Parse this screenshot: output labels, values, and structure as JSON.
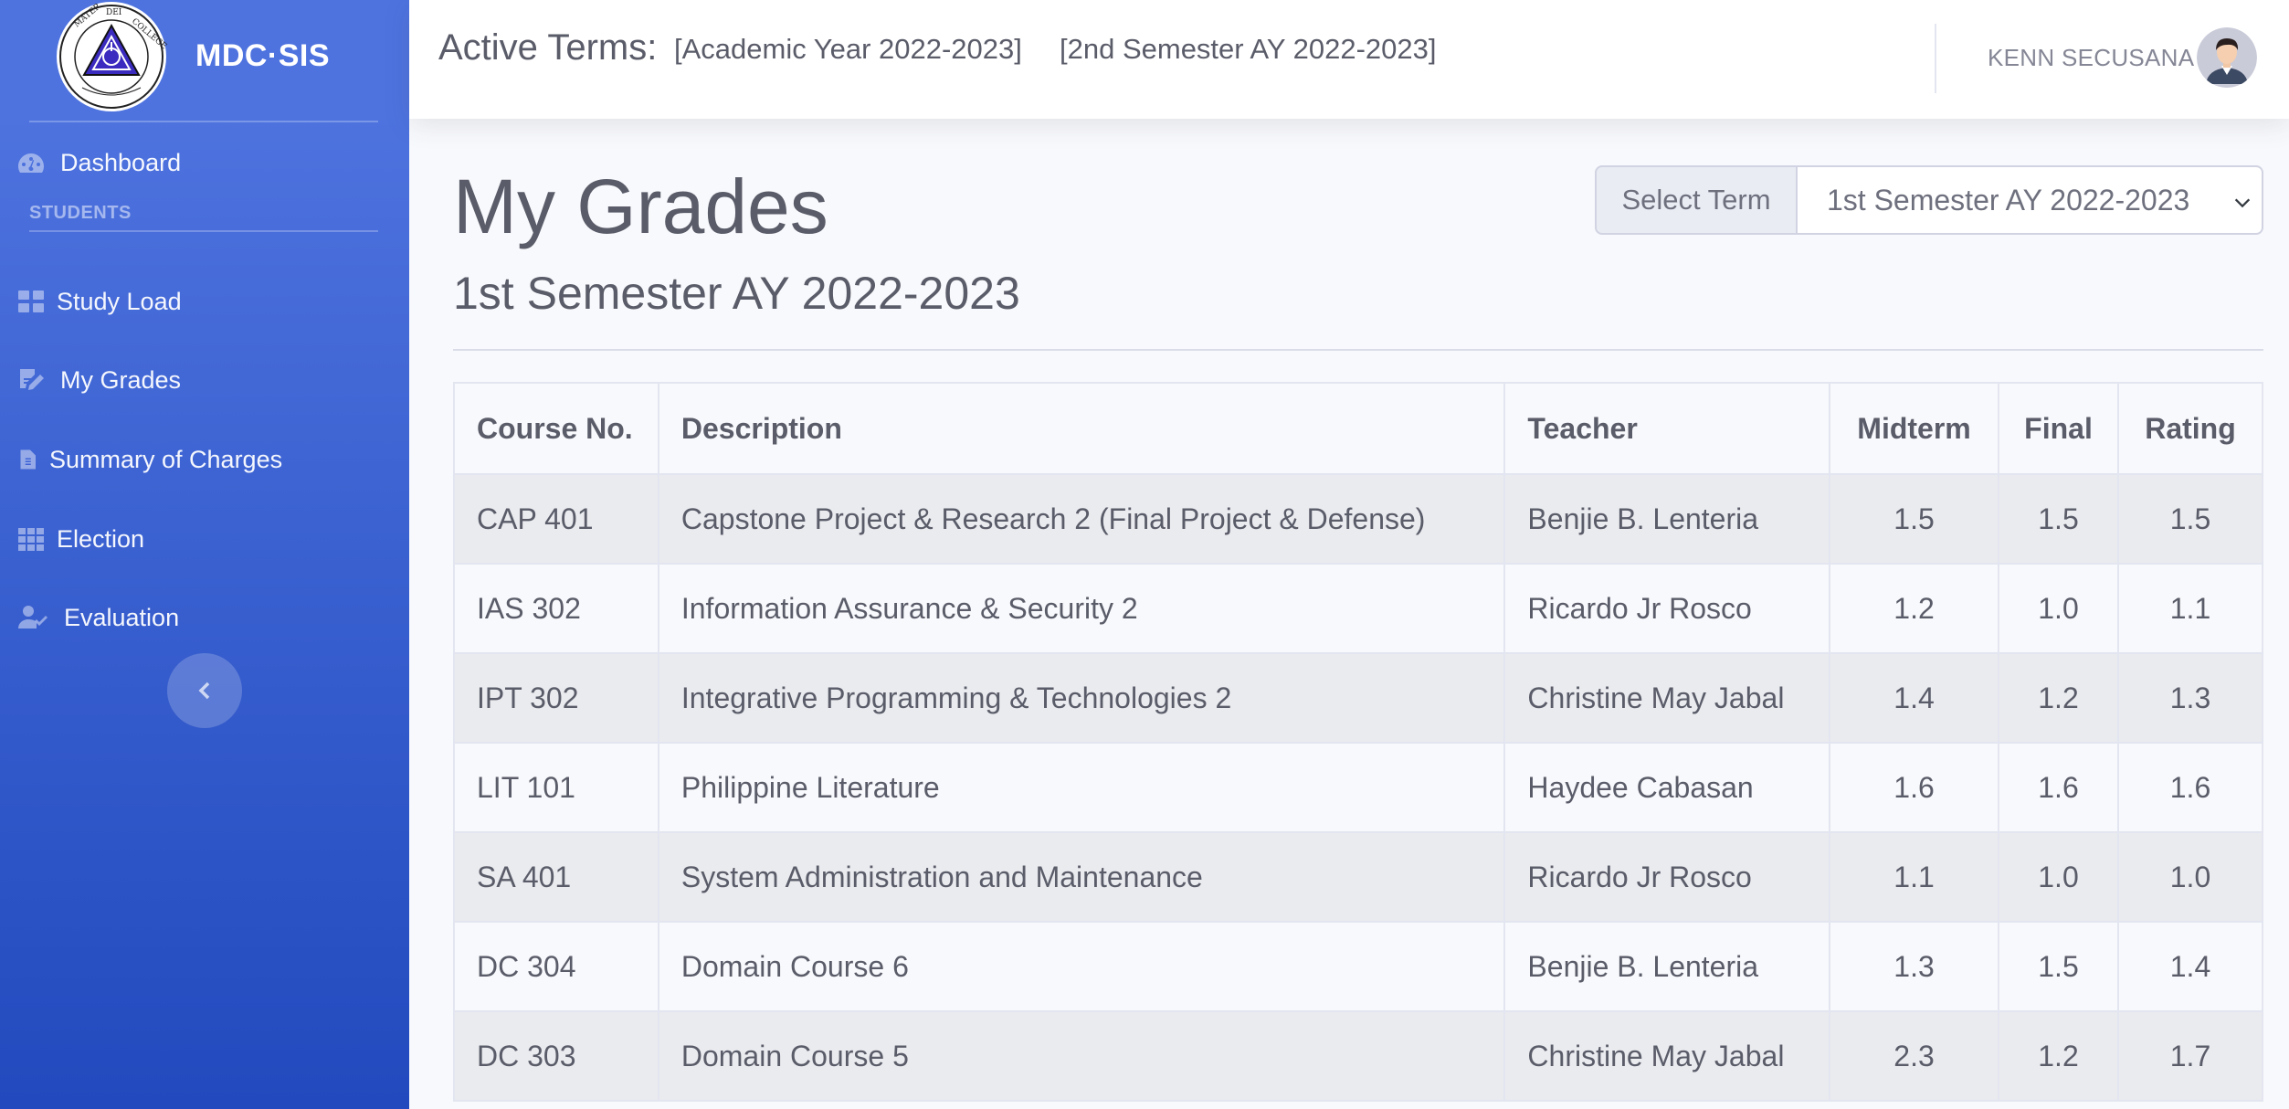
{
  "sidebar": {
    "brand": "MDC·SIS",
    "logo_text": [
      "MATER",
      "DEI",
      "COLLEGE"
    ],
    "dashboard": "Dashboard",
    "heading": "STUDENTS",
    "items": [
      {
        "label": "Study Load",
        "icon": "grid-icon"
      },
      {
        "label": "My Grades",
        "icon": "edit-icon"
      },
      {
        "label": "Summary of Charges",
        "icon": "file-invoice-icon"
      },
      {
        "label": "Election",
        "icon": "th-icon"
      },
      {
        "label": "Evaluation",
        "icon": "user-check-icon"
      }
    ]
  },
  "topbar": {
    "active_label": "Active Terms:",
    "terms": [
      "[Academic Year 2022-2023]",
      "[2nd Semester AY 2022-2023]"
    ],
    "user_name": "KENN SECUSANA"
  },
  "main": {
    "title": "My Grades",
    "subtitle": "1st Semester AY 2022-2023",
    "select_label": "Select Term",
    "select_value": "1st Semester AY 2022-2023"
  },
  "table": {
    "headers": [
      "Course No.",
      "Description",
      "Teacher",
      "Midterm",
      "Final",
      "Rating"
    ],
    "rows": [
      [
        "CAP 401",
        "Capstone Project & Research 2 (Final Project & Defense)",
        "Benjie B. Lenteria",
        "1.5",
        "1.5",
        "1.5"
      ],
      [
        "IAS 302",
        "Information Assurance & Security 2",
        "Ricardo Jr Rosco",
        "1.2",
        "1.0",
        "1.1"
      ],
      [
        "IPT 302",
        "Integrative Programming & Technologies 2",
        "Christine May Jabal",
        "1.4",
        "1.2",
        "1.3"
      ],
      [
        "LIT 101",
        "Philippine Literature",
        "Haydee Cabasan",
        "1.6",
        "1.6",
        "1.6"
      ],
      [
        "SA 401",
        "System Administration and Maintenance",
        "Ricardo Jr Rosco",
        "1.1",
        "1.0",
        "1.0"
      ],
      [
        "DC 304",
        "Domain Course 6",
        "Benjie B. Lenteria",
        "1.3",
        "1.5",
        "1.4"
      ],
      [
        "DC 303",
        "Domain Course 5",
        "Christine May Jabal",
        "2.3",
        "1.2",
        "1.7"
      ]
    ]
  },
  "colors": {
    "sidebar_top": "#4e73df",
    "sidebar_bottom": "#224abe",
    "text": "#5a5c69",
    "row_stripe": "#eaebef"
  }
}
